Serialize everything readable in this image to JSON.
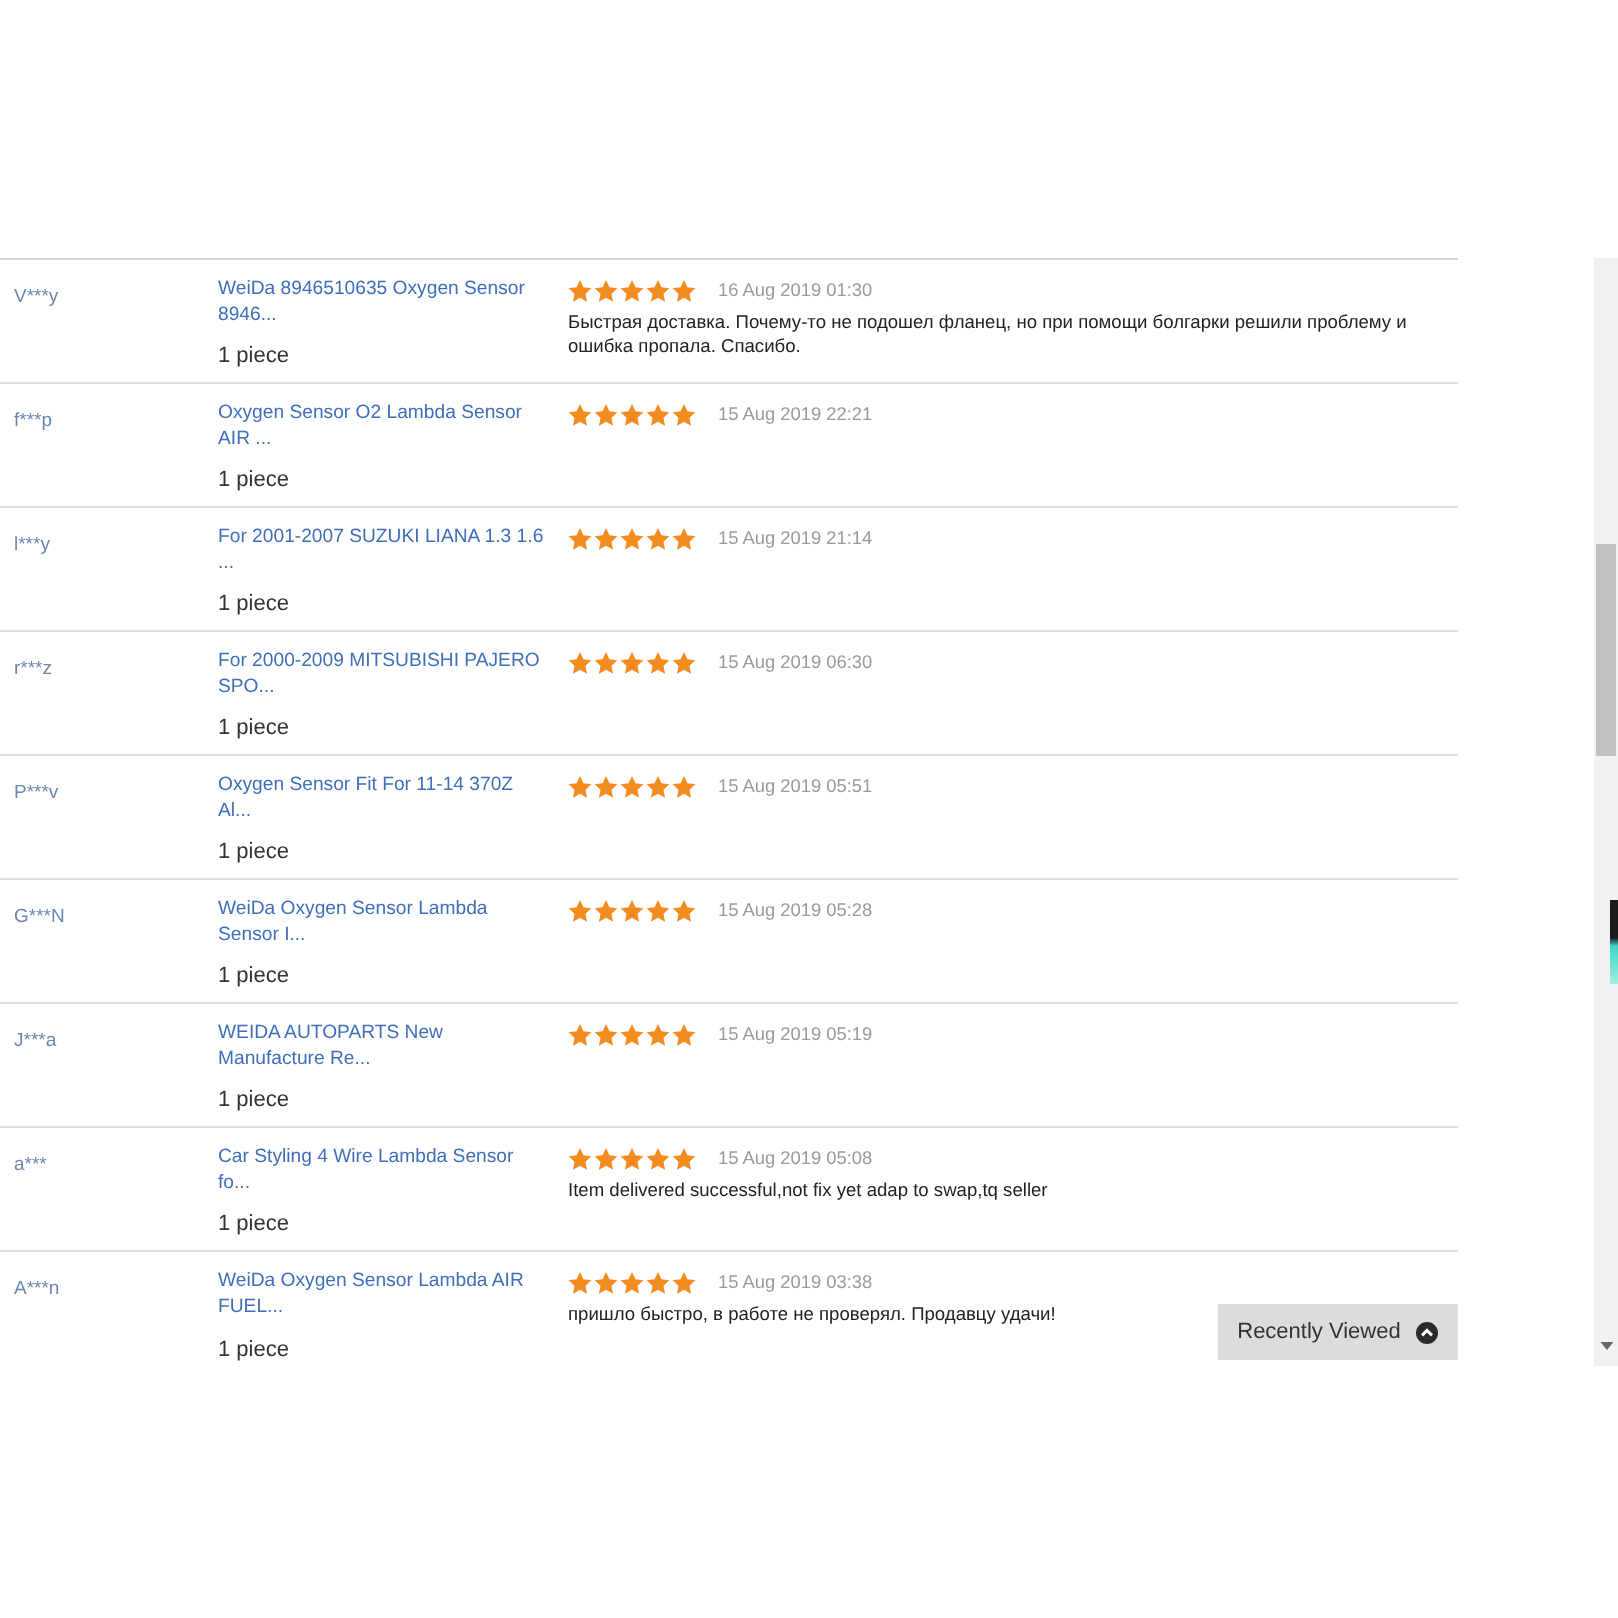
{
  "reviews": {
    "rows": [
      {
        "buyer": "V***y",
        "product": "WeiDa 8946510635 Oxygen Sensor 8946...",
        "quantity": "1 piece",
        "stars": 5,
        "date": "16 Aug 2019 01:30",
        "feedback": "Быстрая доставка. Почему-то не подошел фланец, но при помощи болгарки решили проблему и ошибка пропала. Спасибо."
      },
      {
        "buyer": "f***p",
        "product": "Oxygen Sensor O2 Lambda Sensor AIR ...",
        "quantity": "1 piece",
        "stars": 5,
        "date": "15 Aug 2019 22:21"
      },
      {
        "buyer": "l***y",
        "product": "For 2001-2007 SUZUKI LIANA 1.3 1.6 ...",
        "quantity": "1 piece",
        "stars": 5,
        "date": "15 Aug 2019 21:14"
      },
      {
        "buyer": "r***z",
        "product": "For 2000-2009 MITSUBISHI PAJERO SPO...",
        "quantity": "1 piece",
        "stars": 5,
        "date": "15 Aug 2019 06:30"
      },
      {
        "buyer": "P***v",
        "product": "Oxygen Sensor Fit For 11-14 370Z Al...",
        "quantity": "1 piece",
        "stars": 5,
        "date": "15 Aug 2019 05:51"
      },
      {
        "buyer": "G***N",
        "product": "WeiDa Oxygen Sensor Lambda Sensor I...",
        "quantity": "1 piece",
        "stars": 5,
        "date": "15 Aug 2019 05:28"
      },
      {
        "buyer": "J***a",
        "product": "WEIDA AUTOPARTS New Manufacture Re...",
        "quantity": "1 piece",
        "stars": 5,
        "date": "15 Aug 2019 05:19"
      },
      {
        "buyer": "a***",
        "product": "Car Styling 4 Wire Lambda Sensor fo...",
        "quantity": "1 piece",
        "stars": 5,
        "date": "15 Aug 2019 05:08",
        "feedback": "Item delivered successful,not fix yet adap to swap,tq seller"
      },
      {
        "buyer": "A***n",
        "product": "WeiDa Oxygen Sensor Lambda AIR FUEL...",
        "quantity": "1 piece",
        "stars": 5,
        "date": "15 Aug 2019 03:38",
        "feedback": "пришло быстро, в работе не проверял. Продавцу удачи!"
      }
    ]
  },
  "recently_viewed": {
    "label": "Recently Viewed"
  }
}
